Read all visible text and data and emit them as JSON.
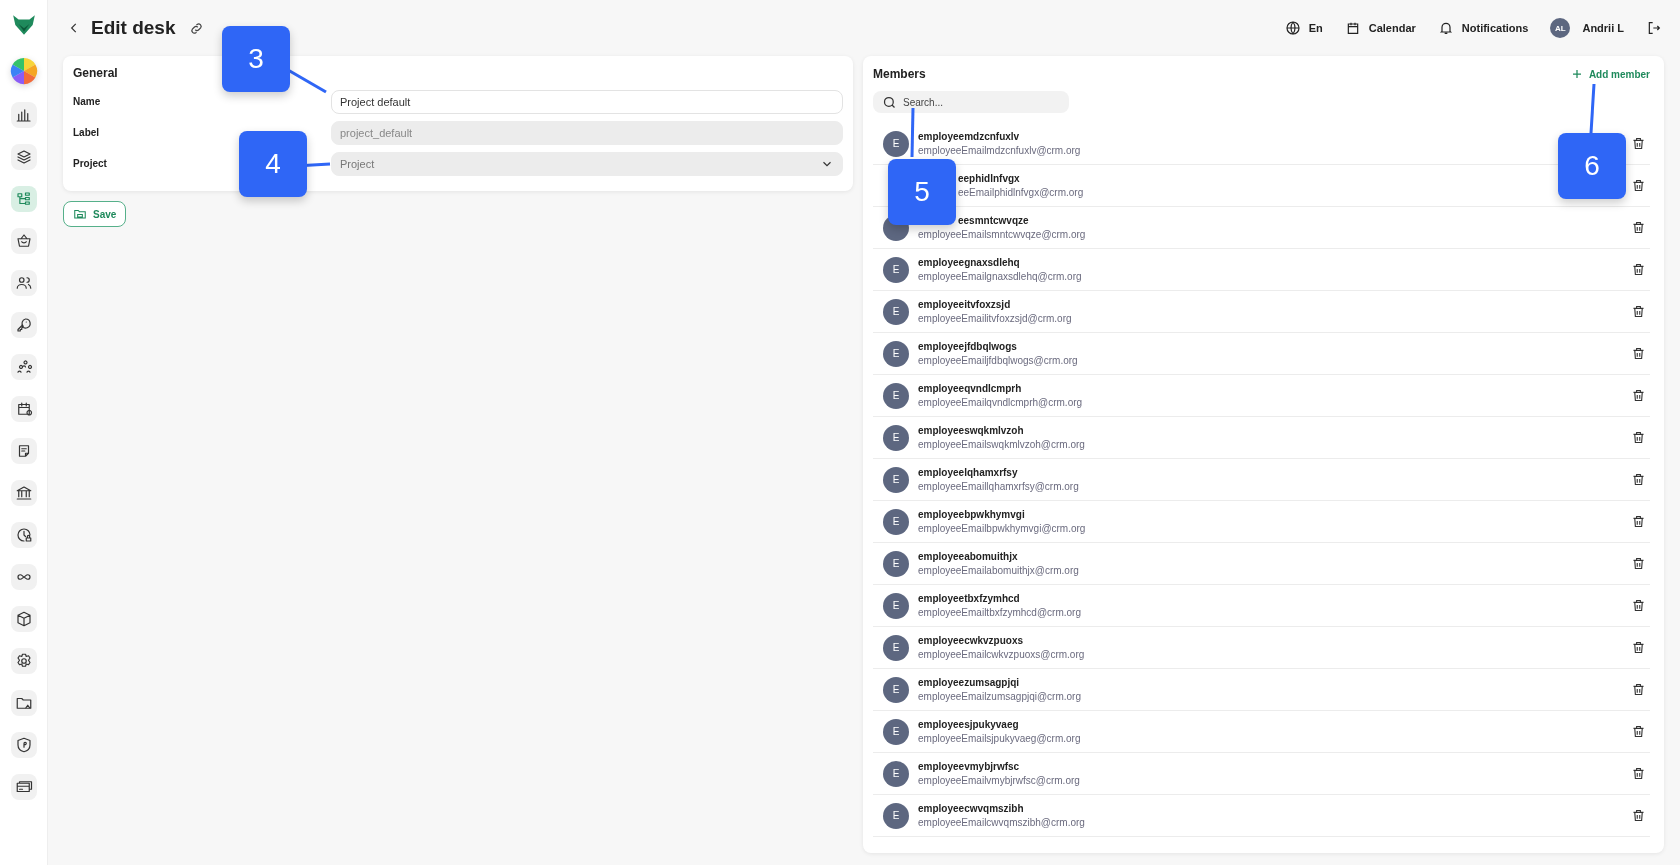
{
  "sidebar": {
    "items": [
      {
        "selected": false
      },
      {
        "selected": false
      },
      {
        "selected": true
      },
      {
        "selected": false
      },
      {
        "selected": false
      },
      {
        "selected": false
      },
      {
        "selected": false
      },
      {
        "selected": false
      },
      {
        "selected": false
      },
      {
        "selected": false
      },
      {
        "selected": false
      },
      {
        "selected": false
      },
      {
        "selected": false
      },
      {
        "selected": false
      },
      {
        "selected": false
      },
      {
        "selected": false
      },
      {
        "selected": false
      }
    ]
  },
  "header": {
    "title": "Edit desk",
    "language": "En",
    "calendar": "Calendar",
    "notifications": "Notifications",
    "user_initials": "AL",
    "user_name": "Andrii L"
  },
  "general": {
    "title": "General",
    "fields": [
      {
        "label": "Name",
        "kind": "input",
        "value": "Project default",
        "disabled": false
      },
      {
        "label": "Label",
        "kind": "input",
        "value": "project_default",
        "disabled": true
      },
      {
        "label": "Project",
        "kind": "select",
        "placeholder": "Project",
        "disabled": false
      }
    ],
    "save": "Save"
  },
  "members": {
    "title": "Members",
    "add": "Add member",
    "search_placeholder": "Search...",
    "rows": [
      {
        "kind": "plain",
        "initial": "E",
        "name": "employeemdzcnfuxlv",
        "email": "employeeEmailmdzcnfuxlv@crm.org"
      },
      {
        "kind": "covered",
        "name": "eephidlnfvgx",
        "email": "eeEmailphidlnfvgx@crm.org"
      },
      {
        "kind": "name_covered",
        "name": "eesmntcwvqze",
        "email": "employeeEmailsmntcwvqze@crm.org"
      },
      {
        "kind": "plain",
        "initial": "E",
        "name": "employeegnaxsdlehq",
        "email": "employeeEmailgnaxsdlehq@crm.org"
      },
      {
        "kind": "plain",
        "initial": "E",
        "name": "employeeitvfoxzsjd",
        "email": "employeeEmailitvfoxzsjd@crm.org"
      },
      {
        "kind": "plain",
        "initial": "E",
        "name": "employeejfdbqlwogs",
        "email": "employeeEmailjfdbqlwogs@crm.org"
      },
      {
        "kind": "plain",
        "initial": "E",
        "name": "employeeqvndlcmprh",
        "email": "employeeEmailqvndlcmprh@crm.org"
      },
      {
        "kind": "plain",
        "initial": "E",
        "name": "employeeswqkmlvzoh",
        "email": "employeeEmailswqkmlvzoh@crm.org"
      },
      {
        "kind": "plain",
        "initial": "E",
        "name": "employeelqhamxrfsy",
        "email": "employeeEmaillqhamxrfsy@crm.org"
      },
      {
        "kind": "plain",
        "initial": "E",
        "name": "employeebpwkhymvgi",
        "email": "employeeEmailbpwkhymvgi@crm.org"
      },
      {
        "kind": "plain",
        "initial": "E",
        "name": "employeeabomuithjx",
        "email": "employeeEmailabomuithjx@crm.org"
      },
      {
        "kind": "plain",
        "initial": "E",
        "name": "employeetbxfzymhcd",
        "email": "employeeEmailtbxfzymhcd@crm.org"
      },
      {
        "kind": "plain",
        "initial": "E",
        "name": "employeecwkvzpuoxs",
        "email": "employeeEmailcwkvzpuoxs@crm.org"
      },
      {
        "kind": "plain",
        "initial": "E",
        "name": "employeezumsagpjqi",
        "email": "employeeEmailzumsagpjqi@crm.org"
      },
      {
        "kind": "plain",
        "initial": "E",
        "name": "employeesjpukyvaeg",
        "email": "employeeEmailsjpukyvaeg@crm.org"
      },
      {
        "kind": "plain",
        "initial": "E",
        "name": "employeevmybjrwfsc",
        "email": "employeeEmailvmybjrwfsc@crm.org"
      },
      {
        "kind": "plain",
        "initial": "E",
        "name": "employeecwvqmszibh",
        "email": "employeeEmailcwvqmszibh@crm.org"
      }
    ]
  },
  "callouts": [
    {
      "label": "3"
    },
    {
      "label": "4"
    },
    {
      "label": "5"
    },
    {
      "label": "6"
    }
  ]
}
